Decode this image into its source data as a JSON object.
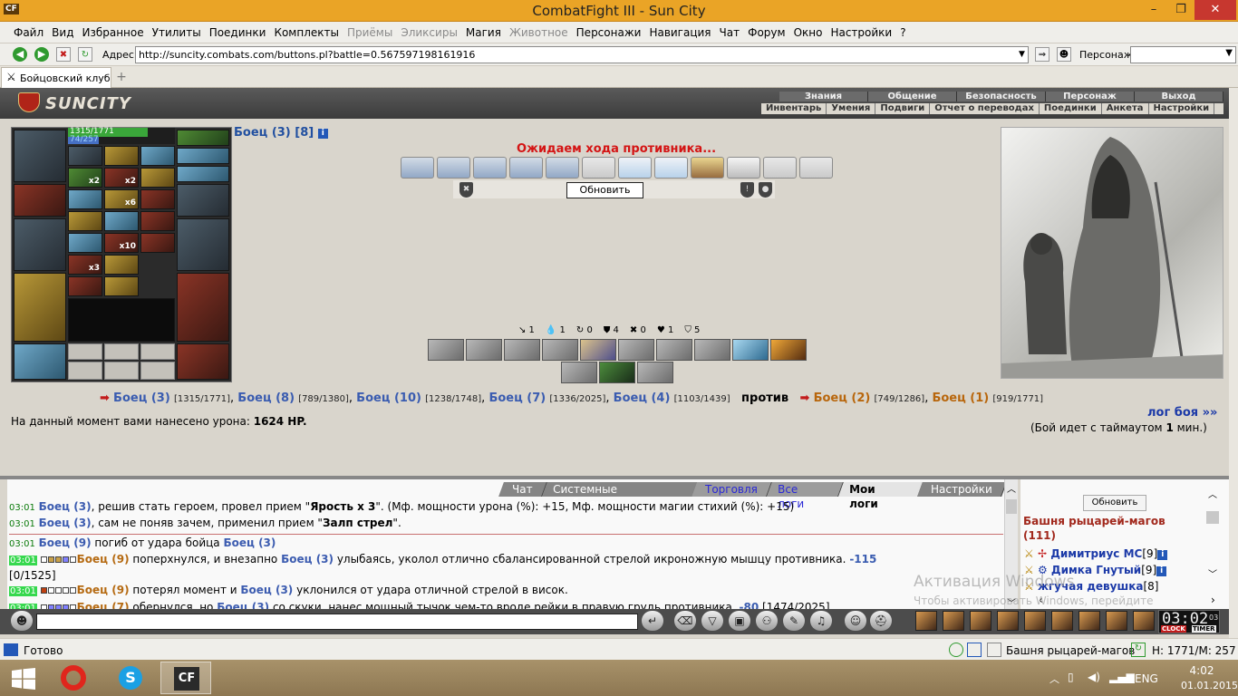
{
  "window": {
    "app_icon": "CF",
    "title": "CombatFight III - Sun City",
    "minimize": "–",
    "restore": "❐",
    "close": "✕"
  },
  "menu": [
    {
      "label": "Файл",
      "disabled": false
    },
    {
      "label": "Вид",
      "disabled": false
    },
    {
      "label": "Избранное",
      "disabled": false
    },
    {
      "label": "Утилиты",
      "disabled": false
    },
    {
      "label": "Поединки",
      "disabled": false
    },
    {
      "label": "Комплекты",
      "disabled": false
    },
    {
      "label": "Приёмы",
      "disabled": true
    },
    {
      "label": "Эликсиры",
      "disabled": true
    },
    {
      "label": "Магия",
      "disabled": false
    },
    {
      "label": "Животное",
      "disabled": true
    },
    {
      "label": "Персонажи",
      "disabled": false
    },
    {
      "label": "Навигация",
      "disabled": false
    },
    {
      "label": "Чат",
      "disabled": false
    },
    {
      "label": "Форум",
      "disabled": false
    },
    {
      "label": "Окно",
      "disabled": false
    },
    {
      "label": "Настройки",
      "disabled": false
    },
    {
      "label": "?",
      "disabled": false
    }
  ],
  "address": {
    "label": "Адрес:",
    "url": "http://suncity.combats.com/buttons.pl?battle=0.567597198161916",
    "character_label": "Персонаж:"
  },
  "tab": {
    "label": "Бойцовский клуб",
    "add": "+"
  },
  "site": {
    "logo": "SUNCITY",
    "top_nav": [
      "Знания",
      "Общение",
      "Безопасность",
      "Персонаж",
      "Выход"
    ],
    "sub_nav": [
      "Инвентарь",
      "Умения",
      "Подвиги",
      "Отчет о переводах",
      "Поединки",
      "Анкета",
      "Настройки"
    ]
  },
  "player": {
    "name": "Боец (3) [8]",
    "hp": "1315/1771",
    "mp": "74/257",
    "hp_fraction": 0.743,
    "mp_fraction": 0.288,
    "belt": [
      {
        "qty": "x2"
      },
      {
        "qty": "x2"
      },
      {
        "qty": "x6"
      },
      {
        "qty": "x10"
      },
      {
        "qty": "x3"
      }
    ]
  },
  "battle": {
    "status": "Ожидаем хода противника...",
    "update_button": "Обновить",
    "stats": [
      "↘ 1",
      "💧 1",
      "↻ 0",
      "⛊ 4",
      "✖ 0",
      "♥ 1",
      "⛉ 5"
    ],
    "team1": [
      {
        "name": "Боец (3)",
        "hp": "[1315/1771]"
      },
      {
        "name": "Боец (8)",
        "hp": "[789/1380]"
      },
      {
        "name": "Боец (10)",
        "hp": "[1238/1748]"
      },
      {
        "name": "Боец (7)",
        "hp": "[1336/2025]"
      },
      {
        "name": "Боец (4)",
        "hp": "[1103/1439]"
      }
    ],
    "versus": "против",
    "team2": [
      {
        "name": "Боец (2)",
        "hp": "[749/1286]"
      },
      {
        "name": "Боец (1)",
        "hp": "[919/1771]"
      }
    ],
    "log_link": "лог боя »»",
    "damage_prefix": "На данный момент вами нанесено урона:",
    "damage_value": "1624 HP.",
    "timeout_prefix": "(Бой идет с таймаутом",
    "timeout_value": "1",
    "timeout_suffix": "мин.)"
  },
  "chat": {
    "tabs": [
      "Чат",
      "Системные сообщения",
      "Торговля",
      "Все логи",
      "Мои логи",
      "Настройки"
    ],
    "lines": [
      {
        "time": "03:01",
        "name": "Боец (3)",
        "text": ", решив стать героем, провел прием \"",
        "bold": "Ярость x 3",
        "tail": "\". (Мф. мощности урона (%): +15, Мф. мощности магии стихий (%): +15)"
      },
      {
        "time": "03:01",
        "name": "Боец (3)",
        "text": ", сам не поняв зачем, применил прием \"",
        "bold": "Залп стрел",
        "tail": "\"."
      },
      {
        "time": "03:01",
        "name": "Боец (9)",
        "text": " погиб от удара бойца ",
        "bold": "Боец (3)",
        "tail": ""
      },
      {
        "time": "03:01",
        "name": "Боец (9)",
        "text": " поперхнулся, и внезапно ",
        "name2": "Боец (3)",
        "tail": " улыбаясь, уколол отлично сбалансированной стрелой икроножную мышцу противника.",
        "dmg": "-115",
        "extra": "[0/1525]"
      },
      {
        "time": "03:01",
        "name": "Боец (9)",
        "text": " потерял момент и ",
        "name2": "Боец (3)",
        "tail": " уклонился от удара отличной стрелой в висок."
      },
      {
        "time": "03:01",
        "name": "Боец (7)",
        "text": " обернулся, но ",
        "name2": "Боец (3)",
        "tail": " со скуки, нанес мощный тычок чем-то вроде рейки в правую грудь противника.",
        "dmg": "-80",
        "extra": "[1474/2025]"
      }
    ]
  },
  "room": {
    "update_button": "Обновить",
    "title": "Башня рыцарей-магов",
    "count": "(111)",
    "users": [
      {
        "name": "Димитриус МС",
        "level": "[9]"
      },
      {
        "name": "Димка Гнутый",
        "level": "[9]"
      },
      {
        "name": "жгучая девушка",
        "level": "[8]"
      }
    ]
  },
  "watermark": {
    "line1": "Активация Windows",
    "line2": "Чтобы активировать Windows, перейдите"
  },
  "clock": {
    "time": "03:02",
    "seconds": "03",
    "clock_label": "CLOCK",
    "timer_label": "TIMER"
  },
  "status": {
    "text": "Готово",
    "room": "Башня рыцарей-магов",
    "hm": "H: 1771/M: 257"
  },
  "taskbar": {
    "lang": "ENG",
    "time": "4:02",
    "date": "01.01.2015",
    "cf_label": "CF"
  },
  "colors": {
    "titlebar": "#eaa426",
    "close": "#c7372f",
    "link": "#3a5cb0",
    "enemy": "#b8660c",
    "alert": "#d41414"
  }
}
